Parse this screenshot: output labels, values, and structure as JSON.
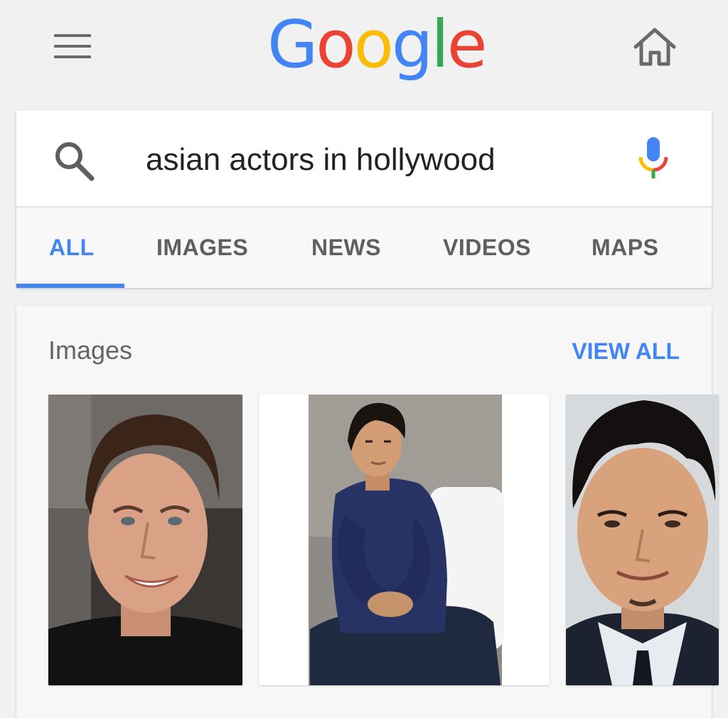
{
  "header": {
    "logo_letters": [
      {
        "char": "G",
        "color": "#4285f4"
      },
      {
        "char": "o",
        "color": "#ea4335"
      },
      {
        "char": "o",
        "color": "#fbbc05"
      },
      {
        "char": "g",
        "color": "#4285f4"
      },
      {
        "char": "l",
        "color": "#34a853"
      },
      {
        "char": "e",
        "color": "#ea4335"
      }
    ],
    "menu_icon": "hamburger-menu-icon",
    "home_icon": "home-icon"
  },
  "search": {
    "query": "asian actors in hollywood",
    "search_icon": "search-icon",
    "mic_icon": "microphone-icon"
  },
  "tabs": [
    {
      "label": "ALL",
      "active": true
    },
    {
      "label": "IMAGES",
      "active": false
    },
    {
      "label": "NEWS",
      "active": false
    },
    {
      "label": "VIDEOS",
      "active": false
    },
    {
      "label": "MAPS",
      "active": false
    }
  ],
  "images_section": {
    "title": "Images",
    "view_all_label": "VIEW ALL",
    "thumbnails": [
      {
        "subject": "smiling man with brown hair, black shirt"
      },
      {
        "subject": "seated man in navy sweater and jeans"
      },
      {
        "subject": "smiling man in suit and tie"
      }
    ]
  },
  "colors": {
    "accent": "#4285f4",
    "background": "#f1f1f1",
    "tab_text": "#5f5f5f"
  }
}
